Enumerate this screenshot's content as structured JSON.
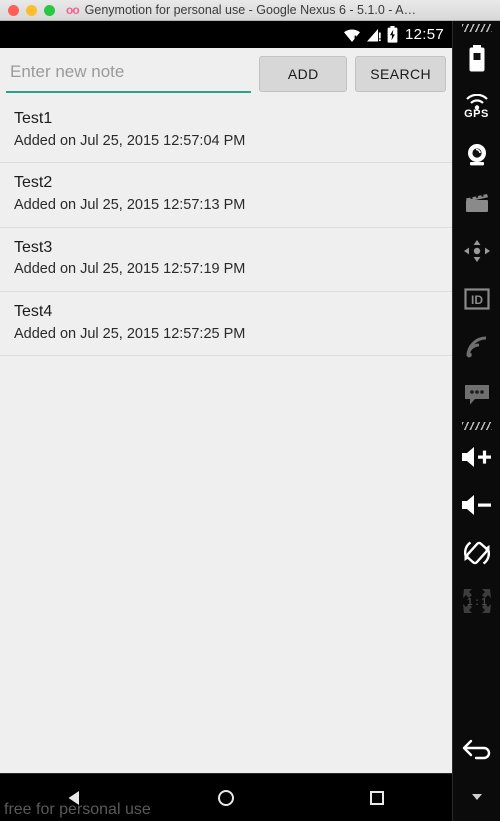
{
  "window": {
    "title": "Genymotion for personal use - Google Nexus 6 - 5.1.0 - A…",
    "logo": "oo",
    "controls": [
      {
        "name": "close",
        "color": "#ff5f57"
      },
      {
        "name": "minimize",
        "color": "#ffbd2e"
      },
      {
        "name": "zoom",
        "color": "#28c840"
      }
    ]
  },
  "statusbar": {
    "clock": "12:57",
    "icons": [
      "wifi-warning-icon",
      "cellular-warning-icon",
      "battery-charging-icon"
    ]
  },
  "toolbar": {
    "input_placeholder": "Enter new note",
    "input_value": "",
    "add_label": "ADD",
    "search_label": "SEARCH",
    "accent_color": "#2ea089"
  },
  "notes": [
    {
      "title": "Test1",
      "subtitle": "Added on Jul 25, 2015 12:57:04 PM"
    },
    {
      "title": "Test2",
      "subtitle": "Added on Jul 25, 2015 12:57:13 PM"
    },
    {
      "title": "Test3",
      "subtitle": "Added on Jul 25, 2015 12:57:19 PM"
    },
    {
      "title": "Test4",
      "subtitle": "Added on Jul 25, 2015 12:57:25 PM"
    }
  ],
  "navbar": {
    "back": "back-icon",
    "home": "home-icon",
    "recents": "recents-icon",
    "watermark": "free for personal use"
  },
  "sidebar": {
    "items": [
      {
        "name": "drag-handle-icon",
        "label": ""
      },
      {
        "name": "battery-icon",
        "label": ""
      },
      {
        "name": "gps-icon",
        "label": "GPS"
      },
      {
        "name": "camera-icon",
        "label": ""
      },
      {
        "name": "video-record-icon",
        "label": ""
      },
      {
        "name": "accelerometer-icon",
        "label": ""
      },
      {
        "name": "identifiers-icon",
        "label": "ID"
      },
      {
        "name": "network-icon",
        "label": ""
      },
      {
        "name": "sms-icon",
        "label": ""
      },
      {
        "name": "drag-handle-icon-2",
        "label": ""
      },
      {
        "name": "volume-up-icon",
        "label": ""
      },
      {
        "name": "volume-down-icon",
        "label": ""
      },
      {
        "name": "rotate-icon",
        "label": ""
      },
      {
        "name": "zoom-reset-icon",
        "label": "1 : 1"
      },
      {
        "name": "back-icon",
        "label": ""
      },
      {
        "name": "collapse-icon",
        "label": ""
      }
    ]
  }
}
